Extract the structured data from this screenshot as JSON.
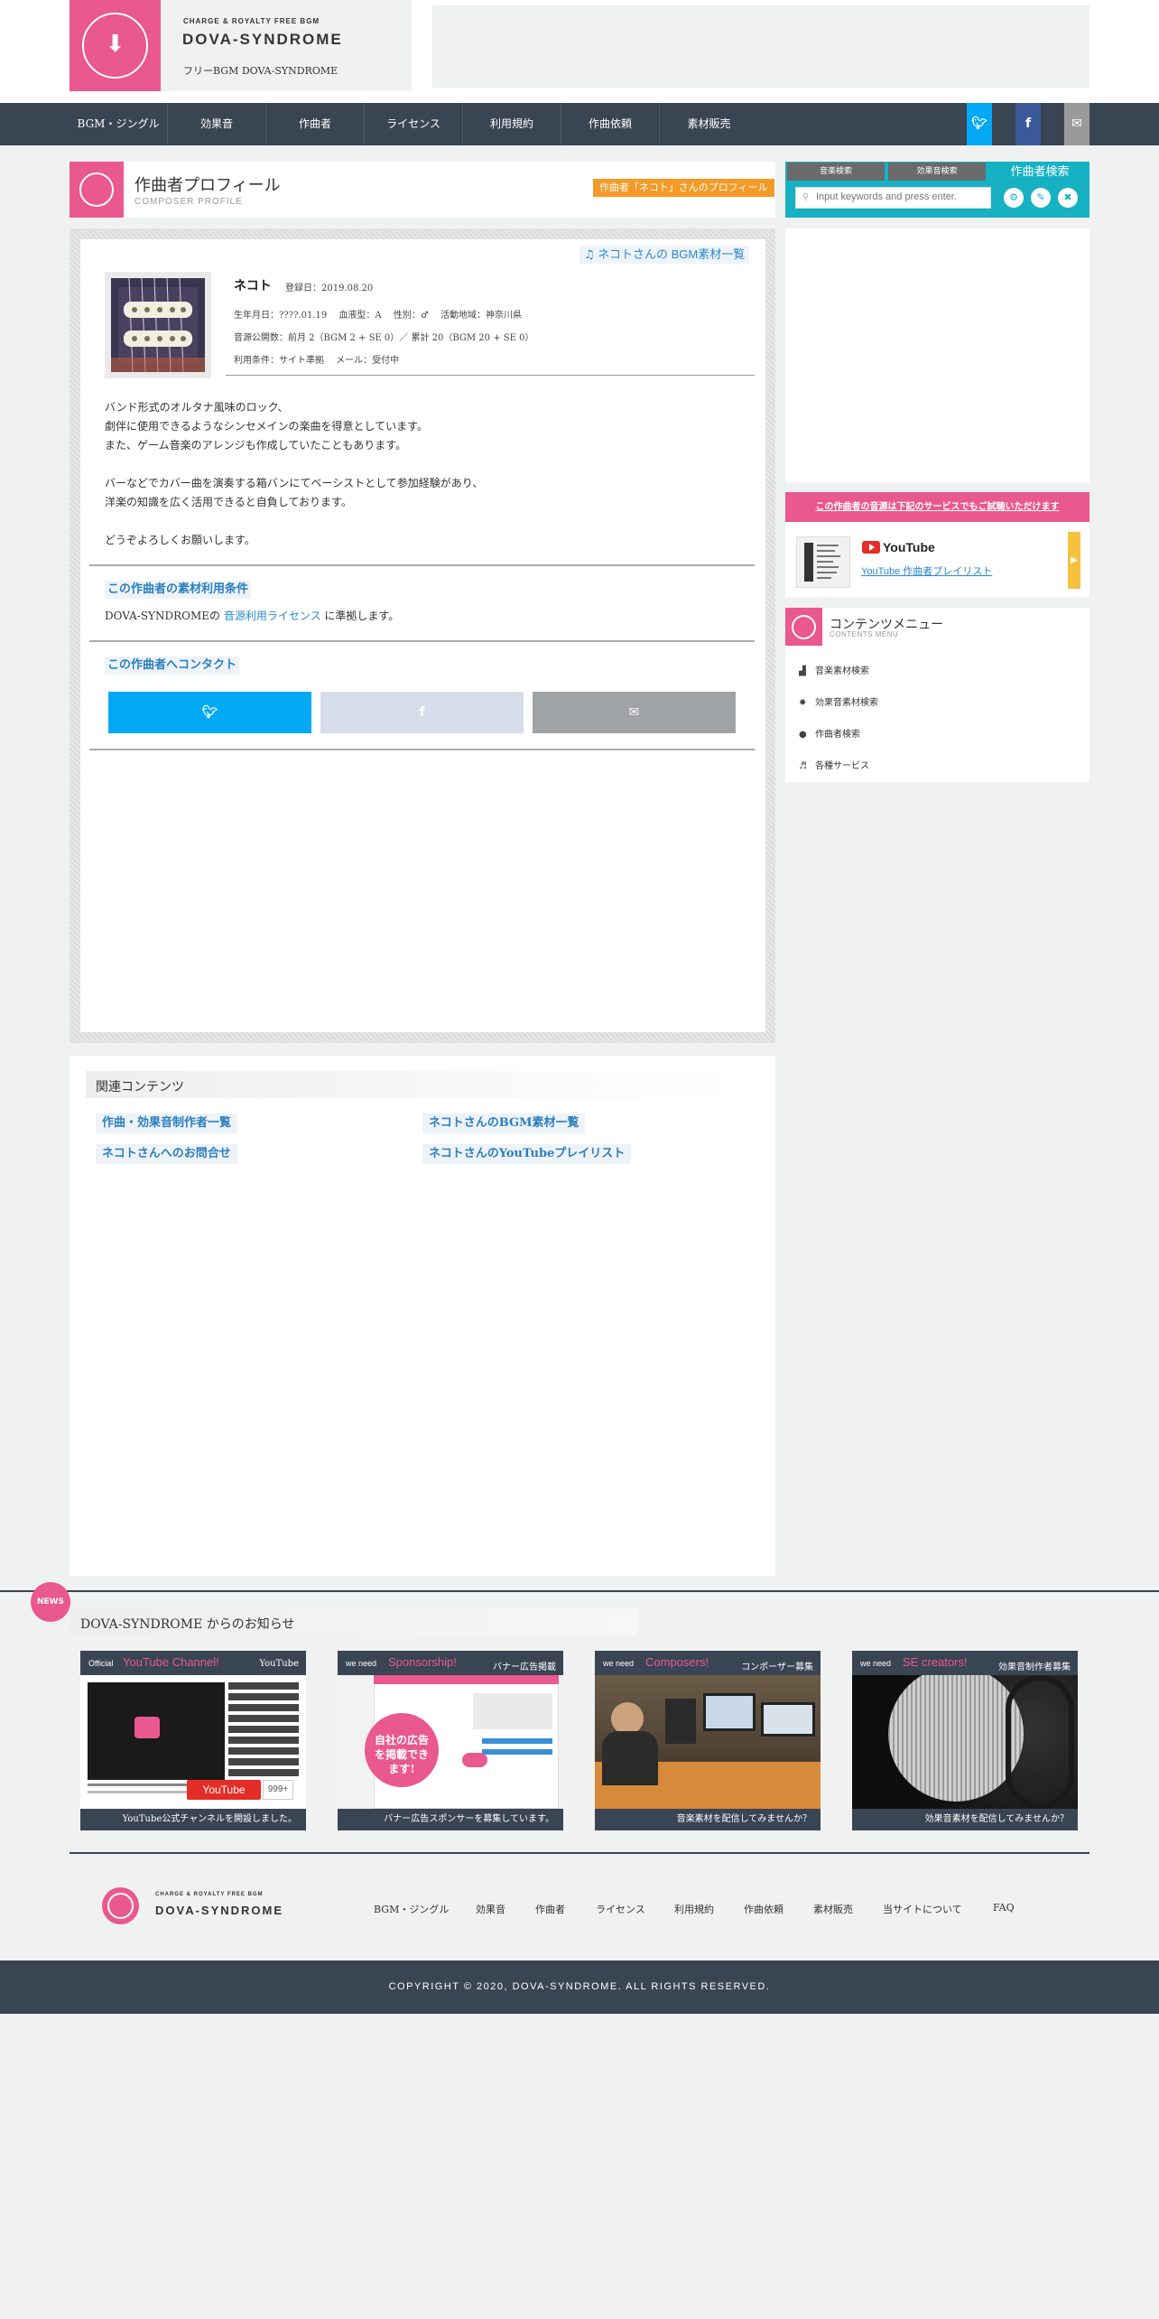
{
  "header": {
    "tagline": "CHARGE & ROYALTY FREE BGM",
    "site_name": "DOVA-SYNDROME",
    "site_sub": "フリーBGM DOVA-SYNDROME"
  },
  "nav": {
    "items": [
      "BGM・ジングル",
      "効果音",
      "作曲者",
      "ライセンス",
      "利用規約",
      "作曲依頼",
      "素材販売"
    ]
  },
  "profile_header": {
    "title": "作曲者プロフィール",
    "subtitle": "COMPOSER PROFILE",
    "badge": "作曲者「ネコト」さんのプロフィール"
  },
  "profile": {
    "bgm_link": "ネコトさんの BGM素材一覧",
    "name": "ネコト",
    "registered": "登録日：2019.08.20",
    "info_line1": "生年月日：????.01.19　  血液型：A　  性別：♂　  活動地域：神奈川県",
    "info_line2": "音源公開数：前月 2（BGM 2 + SE 0）／ 累計 20（BGM 20 + SE 0）",
    "info_line3": "利用条件：サイト準拠　  メール：受付中",
    "bio": [
      "バンド形式のオルタナ風味のロック、",
      "劇伴に使用できるようなシンセメインの楽曲を得意としています。",
      "また、ゲーム音楽のアレンジも作成していたこともあります。",
      "",
      "バーなどでカバー曲を演奏する箱バンにてベーシストとして参加経験があり、",
      "洋楽の知識を広く活用できると自負しております。",
      "",
      "どうぞよろしくお願いします。"
    ]
  },
  "terms": {
    "heading": "この作曲者の素材利用条件",
    "prefix": "DOVA-SYNDROMEの ",
    "link": "音源利用ライセンス",
    "suffix": " に準拠します。"
  },
  "contact": {
    "heading": "この作曲者へコンタクト"
  },
  "related": {
    "title": "関連コンテンツ",
    "links": [
      "作曲・効果音制作者一覧",
      "ネコトさんのBGM素材一覧",
      "ネコトさんへのお問合せ",
      "ネコトさんのYouTubeプレイリスト"
    ]
  },
  "sidebar": {
    "tabs": [
      "音楽検索",
      "効果音検索"
    ],
    "active_tab": "作曲者検索",
    "search_placeholder": "Input keywords and press enter.",
    "trial_heading": "この作曲者の音源は下記のサービスでもご試聴いただけます",
    "yt_logo": "YouTube",
    "yt_playlist": "YouTube 作曲者プレイリスト",
    "menu_title": "コンテンツメニュー",
    "menu_sub": "CONTENTS MENU",
    "menu_items": [
      "音楽素材検索",
      "効果音素材検索",
      "作曲者検索",
      "各種サービス"
    ]
  },
  "news": {
    "badge": "NEWS",
    "title": "DOVA-SYNDROME からのお知らせ",
    "cards": [
      {
        "we": "Official",
        "headline": "YouTube Channel!",
        "tag": "YouTube",
        "caption": "YouTube公式チャンネルを開設しました。"
      },
      {
        "we": "we need",
        "headline": "Sponsorship!",
        "tag": "バナー広告掲載",
        "caption": "バナー広告スポンサーを募集しています。"
      },
      {
        "we": "we need",
        "headline": "Composers!",
        "tag": "コンポーザー募集",
        "caption": "音楽素材を配信してみませんか？"
      },
      {
        "we": "we need",
        "headline": "SE creators!",
        "tag": "効果音制作者募集",
        "caption": "効果音素材を配信してみませんか？"
      }
    ],
    "yt_button": "YouTube",
    "yt_count": "999+",
    "sponsor_text": "自社の広告を掲載できます!"
  },
  "footer": {
    "tagline": "CHARGE & ROYALTY FREE BGM",
    "site_name": "DOVA-SYNDROME",
    "links": [
      "BGM・ジングル",
      "効果音",
      "作曲者",
      "ライセンス",
      "利用規約",
      "作曲依頼",
      "素材販売",
      "当サイトについて",
      "FAQ"
    ],
    "copyright": "COPYRIGHT © 2020, DOVA-SYNDROME. ALL RIGHTS RESERVED."
  },
  "colors": {
    "brand_pink": "#e9588e",
    "nav_dark": "#3a4554",
    "accent_teal": "#17b1c4",
    "badge_orange": "#f39a27",
    "twitter_blue": "#03a9f4",
    "facebook_blue": "#3b5998"
  },
  "icons": {
    "twitter": "twitter-icon",
    "facebook": "facebook-icon",
    "mail": "mail-icon",
    "music_note": "music-note-icon",
    "search": "search-icon"
  }
}
